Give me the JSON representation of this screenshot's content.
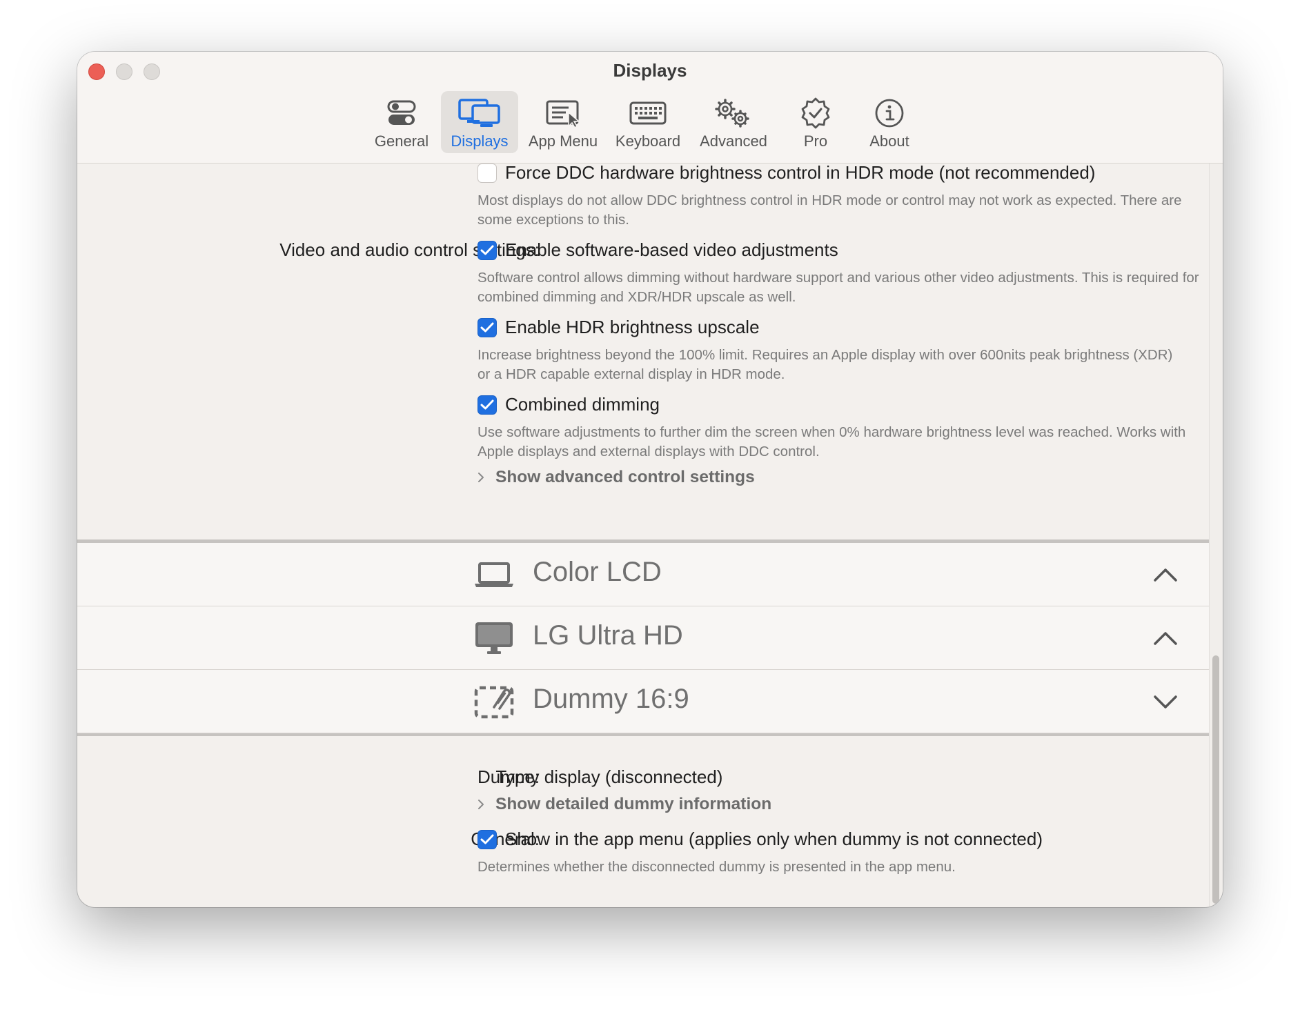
{
  "window": {
    "title": "Displays"
  },
  "toolbar": {
    "items": [
      {
        "label": "General",
        "icon": "toggles-icon",
        "active": false
      },
      {
        "label": "Displays",
        "icon": "displays-icon",
        "active": true
      },
      {
        "label": "App Menu",
        "icon": "app-menu-icon",
        "active": false
      },
      {
        "label": "Keyboard",
        "icon": "keyboard-icon",
        "active": false
      },
      {
        "label": "Advanced",
        "icon": "gears-icon",
        "active": false
      },
      {
        "label": "Pro",
        "icon": "seal-check-icon",
        "active": false
      },
      {
        "label": "About",
        "icon": "info-icon",
        "active": false
      }
    ]
  },
  "hdr_section": {
    "force_ddc_label": "Force DDC hardware brightness control in HDR mode (not recommended)",
    "force_ddc_checked": false,
    "force_ddc_desc": "Most displays do not allow DDC brightness control in HDR mode or control may not work as expected. There are some exceptions to this."
  },
  "video_audio": {
    "row_label": "Video and audio control settings:",
    "software_label": "Enable software-based video adjustments",
    "software_checked": true,
    "software_desc": "Software control allows dimming without hardware support and  various other video adjustments. This is required for combined dimming and XDR/HDR upscale as well.",
    "hdr_upscale_label": "Enable HDR brightness upscale",
    "hdr_upscale_checked": true,
    "hdr_upscale_desc": "Increase brightness beyond the 100% limit. Requires an Apple display with over 600nits peak brightness (XDR) or a HDR capable external display in HDR mode.",
    "combined_label": "Combined dimming",
    "combined_checked": true,
    "combined_desc": "Use software adjustments to further dim the screen when 0% hardware brightness level was reached. Works with Apple displays and external displays with DDC control.",
    "advanced_disclosure": "Show advanced control settings"
  },
  "displays": [
    {
      "name": "Color LCD",
      "icon": "laptop-icon",
      "expanded": true
    },
    {
      "name": "LG Ultra HD",
      "icon": "monitor-icon",
      "expanded": true
    },
    {
      "name": "Dummy 16:9",
      "icon": "dummy-display-icon",
      "expanded": false
    }
  ],
  "dummy_details": {
    "type_label": "Type:",
    "type_value": "Dummy display (disconnected)",
    "detail_disclosure": "Show detailed dummy information",
    "general_label": "General:",
    "show_in_menu_label": "Show in the app menu (applies only when dummy is not connected)",
    "show_in_menu_checked": true,
    "show_in_menu_desc": "Determines whether the disconnected dummy is presented in the app menu."
  },
  "colors": {
    "accent": "#1f6fe0",
    "close": "#ec5f56",
    "window_bg": "#f3f0ed"
  }
}
